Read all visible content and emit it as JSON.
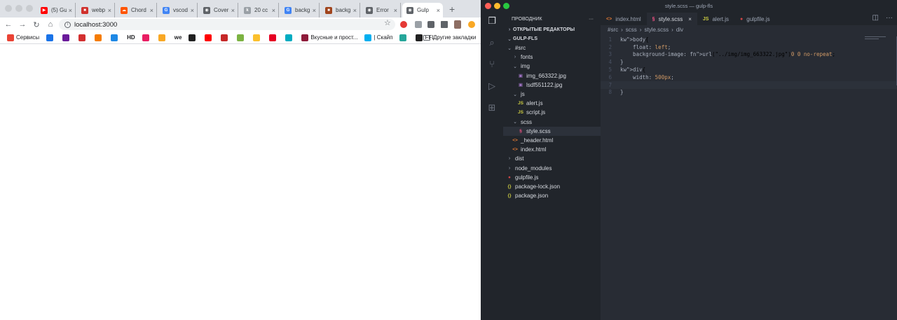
{
  "browser": {
    "tabs": [
      {
        "title": "(5) Gu",
        "color": "#ff0000",
        "glyph": "▶"
      },
      {
        "title": "webp",
        "color": "#d0312d",
        "glyph": "■"
      },
      {
        "title": "Chord",
        "color": "#ff5500",
        "glyph": "☁"
      },
      {
        "title": "vscod",
        "color": "#4285f4",
        "glyph": "G"
      },
      {
        "title": "Cover",
        "color": "#5f6368",
        "glyph": "◉"
      },
      {
        "title": "20 сс",
        "color": "#9aa0a6",
        "glyph": "k"
      },
      {
        "title": "backg",
        "color": "#4285f4",
        "glyph": "G"
      },
      {
        "title": "backg",
        "color": "#a0441c",
        "glyph": "■"
      },
      {
        "title": "Error",
        "color": "#5f6368",
        "glyph": "◉"
      },
      {
        "title": "Gulp",
        "color": "#5f6368",
        "glyph": "◉"
      }
    ],
    "url": "localhost:3000",
    "bookmarks": [
      {
        "label": "Сервисы",
        "color": "#ea4335"
      },
      {
        "label": "",
        "color": "#1a73e8"
      },
      {
        "label": "",
        "color": "#6a1b9a"
      },
      {
        "label": "",
        "color": "#d32f2f"
      },
      {
        "label": "",
        "color": "#f57c00"
      },
      {
        "label": "",
        "color": "#1e88e5"
      },
      {
        "label": "HD",
        "color": ""
      },
      {
        "label": "",
        "color": "#e91e63"
      },
      {
        "label": "",
        "color": "#f9a825"
      },
      {
        "label": "we",
        "color": ""
      },
      {
        "label": "",
        "color": "#212121"
      },
      {
        "label": "",
        "color": "#ff0000"
      },
      {
        "label": "",
        "color": "#c62828"
      },
      {
        "label": "",
        "color": "#7cb342"
      },
      {
        "label": "",
        "color": "#fbc02d"
      },
      {
        "label": "",
        "color": "#e60023"
      },
      {
        "label": "",
        "color": "#00acc1"
      },
      {
        "label": "Вкусные и прост...",
        "color": "#8e1b3a"
      },
      {
        "label": "| Скайп",
        "color": "#00aff0"
      },
      {
        "label": "",
        "color": "#26a69a"
      },
      {
        "label": "FFL",
        "color": "#212121"
      }
    ],
    "other_bookmarks": "Другие закладки"
  },
  "vscode": {
    "window_title": "style.scss — gulp-fls",
    "explorer_title": "ПРОВОДНИК",
    "open_editors": "ОТКРЫТЫЕ РЕДАКТОРЫ",
    "project": "GULP-FLS",
    "tree": [
      {
        "label": "#src",
        "type": "folder-open",
        "depth": 1
      },
      {
        "label": "fonts",
        "type": "folder",
        "depth": 2
      },
      {
        "label": "img",
        "type": "folder-open",
        "depth": 2
      },
      {
        "label": "img_663322.jpg",
        "type": "image",
        "depth": 3
      },
      {
        "label": "lsdf551122.jpg",
        "type": "image",
        "depth": 3
      },
      {
        "label": "js",
        "type": "folder-open",
        "depth": 2
      },
      {
        "label": "alert.js",
        "type": "js",
        "depth": 3
      },
      {
        "label": "script.js",
        "type": "js",
        "depth": 3
      },
      {
        "label": "scss",
        "type": "folder-open",
        "depth": 2
      },
      {
        "label": "style.scss",
        "type": "scss",
        "depth": 3,
        "selected": true
      },
      {
        "label": "_header.html",
        "type": "html",
        "depth": 2
      },
      {
        "label": "index.html",
        "type": "html",
        "depth": 2
      },
      {
        "label": "dist",
        "type": "folder",
        "depth": 1
      },
      {
        "label": "node_modules",
        "type": "folder",
        "depth": 1
      },
      {
        "label": "gulpfile.js",
        "type": "gulp",
        "depth": 1
      },
      {
        "label": "package-lock.json",
        "type": "json",
        "depth": 1
      },
      {
        "label": "package.json",
        "type": "json",
        "depth": 1
      }
    ],
    "tabs": [
      {
        "label": "index.html",
        "icon": "<>",
        "icon_color": "#e37933",
        "active": false
      },
      {
        "label": "style.scss",
        "icon": "§",
        "icon_color": "#f55385",
        "active": true
      },
      {
        "label": "alert.js",
        "icon": "JS",
        "icon_color": "#cbcb41",
        "active": false
      },
      {
        "label": "gulpfile.js",
        "icon": "●",
        "icon_color": "#cf4647",
        "active": false
      }
    ],
    "breadcrumb": [
      "#src",
      "scss",
      "style.scss",
      "div"
    ],
    "code_lines": [
      {
        "num": "1",
        "text": "body {"
      },
      {
        "num": "2",
        "text": "    float: left;"
      },
      {
        "num": "3",
        "text": "    background-image: url(\"../img/img_663322.jpg\") 0 0 no-repeat;"
      },
      {
        "num": "4",
        "text": "}"
      },
      {
        "num": "5",
        "text": "div {"
      },
      {
        "num": "6",
        "text": "    width: 500px;"
      },
      {
        "num": "7",
        "text": ""
      },
      {
        "num": "8",
        "text": "}"
      }
    ]
  }
}
